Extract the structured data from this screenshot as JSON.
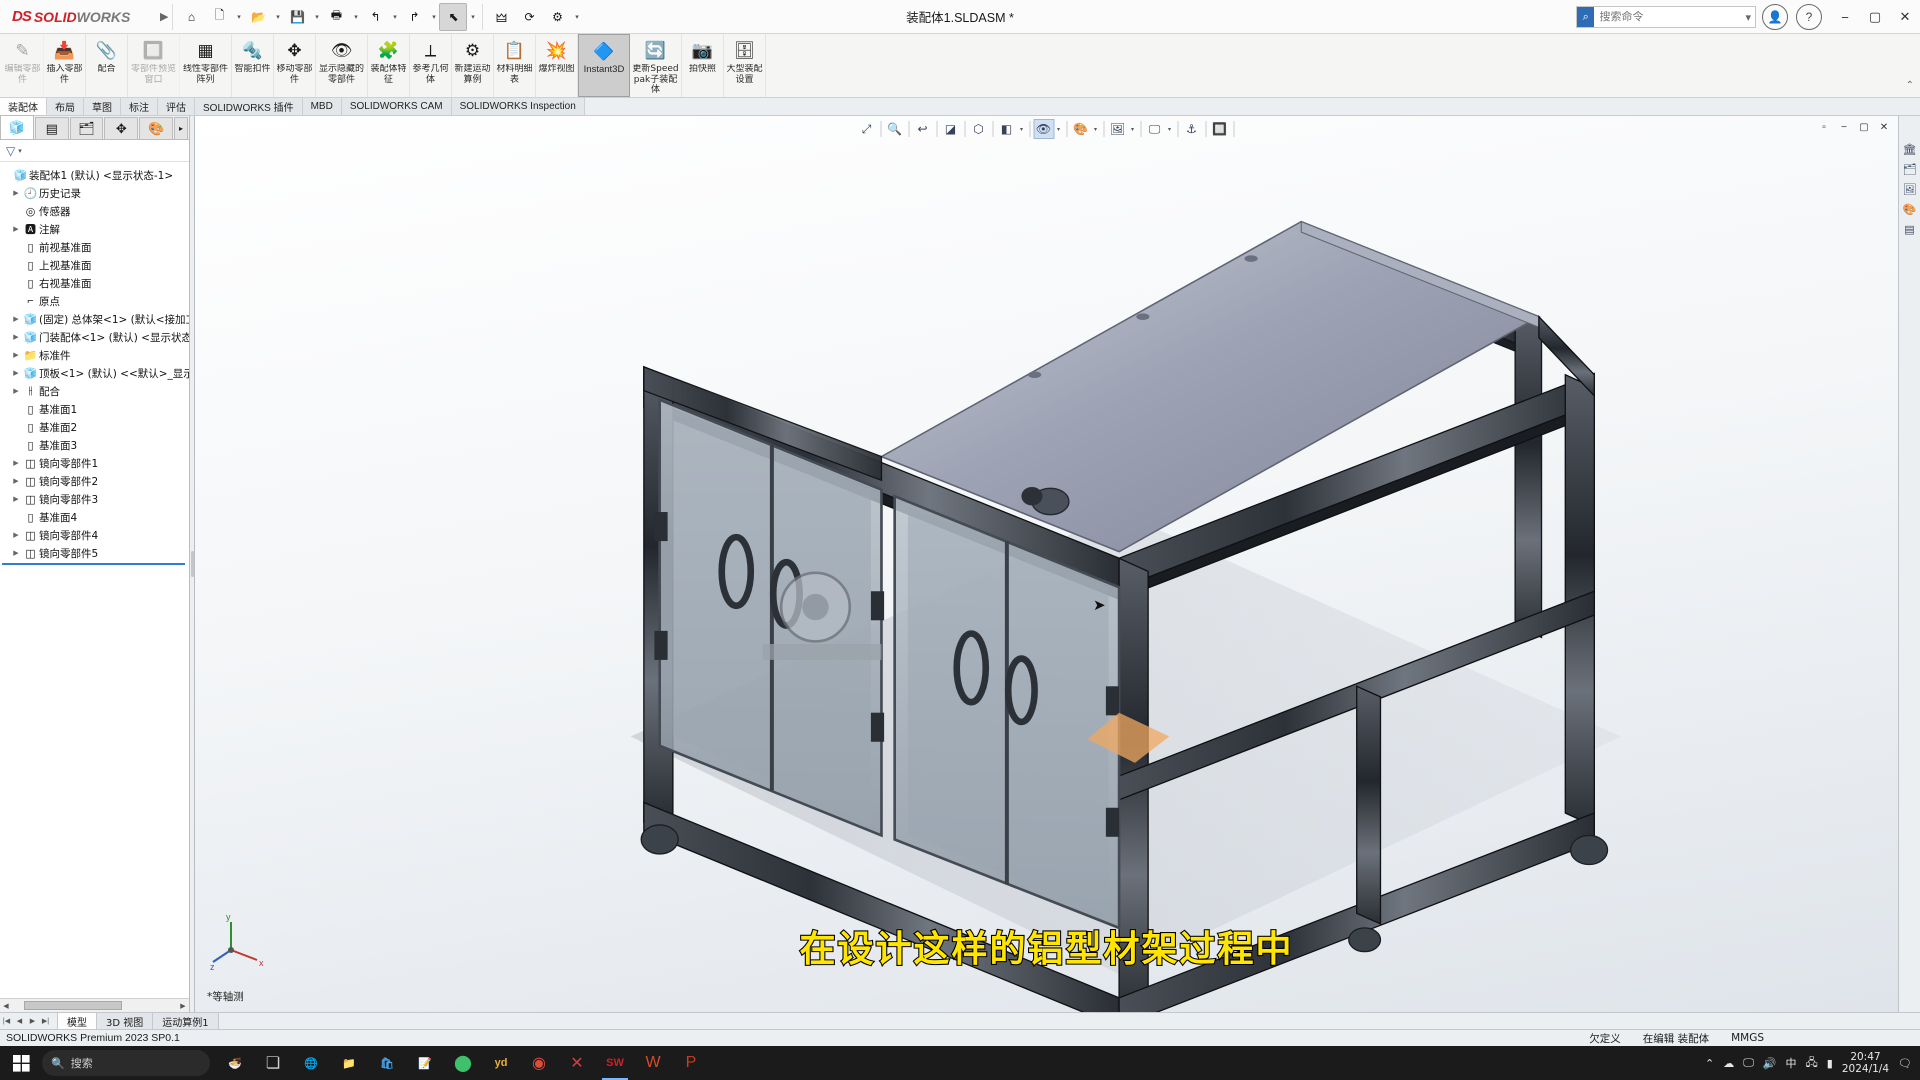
{
  "titlebar": {
    "brand_ds": "DS",
    "brand_sol": "SOLID",
    "brand_works": "WORKS",
    "menu_arrow": "▶",
    "document_title": "装配体1.SLDASM *",
    "search_placeholder": "搜索命令",
    "quick_access": [
      {
        "name": "home-icon",
        "glyph": "⌂",
        "caret": false
      },
      {
        "name": "new-document-icon",
        "glyph": "🗋",
        "caret": true
      },
      {
        "name": "open-folder-icon",
        "glyph": "📂",
        "caret": true
      },
      {
        "name": "save-icon",
        "glyph": "💾",
        "caret": true
      },
      {
        "name": "print-icon",
        "glyph": "🖶",
        "caret": true
      },
      {
        "name": "undo-icon",
        "glyph": "↰",
        "caret": true
      },
      {
        "name": "redo-icon",
        "glyph": "↱",
        "caret": true
      },
      {
        "name": "select-arrow-icon",
        "glyph": "⬉",
        "caret": true
      },
      {
        "name": "measure-icon",
        "glyph": "🜲",
        "caret": false
      },
      {
        "name": "rebuild-icon",
        "glyph": "⟳",
        "caret": false
      },
      {
        "name": "options-gear-icon",
        "glyph": "⚙",
        "caret": true
      }
    ],
    "window_controls": [
      "−",
      "▢",
      "✕"
    ],
    "account_icon": "👤",
    "help_icon": "?"
  },
  "ribbon": {
    "items": [
      {
        "label": "编辑零部件",
        "icon": "✎",
        "disabled": true
      },
      {
        "label": "插入零部件",
        "icon": "📥",
        "disabled": false
      },
      {
        "label": "配合",
        "icon": "📎",
        "disabled": false
      },
      {
        "label": "零部件预览窗口",
        "icon": "🔲",
        "disabled": true
      },
      {
        "label": "线性零部件阵列",
        "icon": "▦",
        "disabled": false
      },
      {
        "label": "智能扣件",
        "icon": "🔩",
        "disabled": false
      },
      {
        "label": "移动零部件",
        "icon": "✥",
        "disabled": false
      },
      {
        "label": "显示隐藏的零部件",
        "icon": "👁",
        "disabled": false
      },
      {
        "label": "装配体特征",
        "icon": "🧩",
        "disabled": false
      },
      {
        "label": "参考几何体",
        "icon": "⟂",
        "disabled": false
      },
      {
        "label": "新建运动算例",
        "icon": "⚙",
        "disabled": false
      },
      {
        "label": "材料明细表",
        "icon": "📋",
        "disabled": false
      },
      {
        "label": "爆炸视图",
        "icon": "💥",
        "disabled": false
      },
      {
        "label": "Instant3D",
        "icon": "🔷",
        "disabled": false,
        "active": true,
        "latin": true
      },
      {
        "label": "更新Speedpak子装配体",
        "icon": "🔄",
        "disabled": false
      },
      {
        "label": "拍快照",
        "icon": "📷",
        "disabled": false
      },
      {
        "label": "大型装配设置",
        "icon": "🗄",
        "disabled": false
      }
    ],
    "collapse_caret": "⌃"
  },
  "command_tabs": [
    {
      "label": "装配体",
      "active": true,
      "latin": false
    },
    {
      "label": "布局",
      "active": false,
      "latin": false
    },
    {
      "label": "草图",
      "active": false,
      "latin": false
    },
    {
      "label": "标注",
      "active": false,
      "latin": false
    },
    {
      "label": "评估",
      "active": false,
      "latin": false
    },
    {
      "label": "SOLIDWORKS 插件",
      "active": false,
      "latin": true
    },
    {
      "label": "MBD",
      "active": false,
      "latin": true
    },
    {
      "label": "SOLIDWORKS CAM",
      "active": false,
      "latin": true
    },
    {
      "label": "SOLIDWORKS Inspection",
      "active": false,
      "latin": true
    }
  ],
  "left_panel": {
    "tabs": [
      {
        "name": "feature-manager-tab",
        "icon": "🧊",
        "active": true
      },
      {
        "name": "property-manager-tab",
        "icon": "▤",
        "active": false
      },
      {
        "name": "configuration-manager-tab",
        "icon": "🗂",
        "active": false
      },
      {
        "name": "dimxpert-manager-tab",
        "icon": "✥",
        "active": false
      },
      {
        "name": "appearances-tab",
        "icon": "🎨",
        "active": false
      },
      {
        "name": "more-tab",
        "icon": "▸",
        "active": false
      }
    ],
    "filter_icon": "▽",
    "filter_caret": "▾",
    "tree": [
      {
        "label": "装配体1 (默认) <显示状态-1>",
        "icon": "🧊",
        "indent": 0,
        "arrow": false,
        "color": "#d4a017"
      },
      {
        "label": "历史记录",
        "icon": "🕘",
        "indent": 1,
        "arrow": true
      },
      {
        "label": "传感器",
        "icon": "◎",
        "indent": 1,
        "arrow": false
      },
      {
        "label": "注解",
        "icon": "🅰",
        "indent": 1,
        "arrow": true
      },
      {
        "label": "前视基准面",
        "icon": "▯",
        "indent": 1,
        "arrow": false
      },
      {
        "label": "上视基准面",
        "icon": "▯",
        "indent": 1,
        "arrow": false
      },
      {
        "label": "右视基准面",
        "icon": "▯",
        "indent": 1,
        "arrow": false
      },
      {
        "label": "原点",
        "icon": "⌐",
        "indent": 1,
        "arrow": false
      },
      {
        "label": "(固定) 总体架<1> (默认<接加工...",
        "icon": "🧊",
        "indent": 1,
        "arrow": true,
        "color": "#d4a017"
      },
      {
        "label": "门装配体<1> (默认) <显示状态-",
        "icon": "🧊",
        "indent": 1,
        "arrow": true,
        "color": "#7fa6cc"
      },
      {
        "label": "标准件",
        "icon": "📁",
        "indent": 1,
        "arrow": true,
        "color": "#3b82c4"
      },
      {
        "label": "顶板<1> (默认) <<默认>_显示状",
        "icon": "🧊",
        "indent": 1,
        "arrow": true,
        "color": "#d4a017"
      },
      {
        "label": "配合",
        "icon": "⫲",
        "indent": 1,
        "arrow": true
      },
      {
        "label": "基准面1",
        "icon": "▯",
        "indent": 1,
        "arrow": false
      },
      {
        "label": "基准面2",
        "icon": "▯",
        "indent": 1,
        "arrow": false
      },
      {
        "label": "基准面3",
        "icon": "▯",
        "indent": 1,
        "arrow": false
      },
      {
        "label": "镜向零部件1",
        "icon": "◫",
        "indent": 1,
        "arrow": true
      },
      {
        "label": "镜向零部件2",
        "icon": "◫",
        "indent": 1,
        "arrow": true
      },
      {
        "label": "镜向零部件3",
        "icon": "◫",
        "indent": 1,
        "arrow": true
      },
      {
        "label": "基准面4",
        "icon": "▯",
        "indent": 1,
        "arrow": false
      },
      {
        "label": "镜向零部件4",
        "icon": "◫",
        "indent": 1,
        "arrow": true
      },
      {
        "label": "镜向零部件5",
        "icon": "◫",
        "indent": 1,
        "arrow": true
      }
    ]
  },
  "viewport": {
    "toolbar": [
      {
        "name": "zoom-to-fit-icon",
        "glyph": "⤢",
        "caret": false
      },
      {
        "name": "zoom-to-area-icon",
        "glyph": "🔍",
        "caret": false
      },
      {
        "name": "previous-view-icon",
        "glyph": "↩",
        "caret": false
      },
      {
        "name": "section-view-icon",
        "glyph": "◪",
        "caret": false
      },
      {
        "name": "view-orientation-icon",
        "glyph": "⬡",
        "caret": false
      },
      {
        "name": "display-style-icon",
        "glyph": "◧",
        "caret": true
      },
      {
        "name": "hide-show-items-icon",
        "glyph": "👁",
        "caret": true,
        "selected": true
      },
      {
        "name": "appearances-icon",
        "glyph": "🎨",
        "caret": true
      },
      {
        "name": "scene-icon",
        "glyph": "🖼",
        "caret": true
      },
      {
        "name": "view-settings-icon",
        "glyph": "🖵",
        "caret": true
      },
      {
        "name": "apply-scene-icon",
        "glyph": "⚓",
        "caret": false
      },
      {
        "name": "hide-all-types-icon",
        "glyph": "🔲",
        "caret": false
      }
    ],
    "window_buttons": [
      "▫",
      "−",
      "▢",
      "✕"
    ],
    "view_label": "*等轴测",
    "axis": {
      "x": "x",
      "y": "y",
      "z": "z"
    }
  },
  "right_toolbar": [
    {
      "name": "design-library-icon",
      "glyph": "🏛"
    },
    {
      "name": "file-explorer-icon",
      "glyph": "🗂"
    },
    {
      "name": "view-palette-icon",
      "glyph": "🖼"
    },
    {
      "name": "appearances-scenes-icon",
      "glyph": "🎨"
    },
    {
      "name": "custom-properties-icon",
      "glyph": "▤"
    }
  ],
  "subtitle": "在设计这样的铝型材架过程中",
  "bottom_tabs": {
    "scroll_arrows": [
      "|◀",
      "◀",
      "▶",
      "▶|"
    ],
    "tabs": [
      {
        "label": "模型",
        "active": true
      },
      {
        "label": "3D 视图",
        "active": false
      },
      {
        "label": "运动算例1",
        "active": false
      }
    ]
  },
  "statusbar": {
    "left": "SOLIDWORKS Premium 2023 SP0.1",
    "state": "欠定义",
    "editing": "在编辑 装配体",
    "units": "MMGS"
  },
  "taskbar": {
    "search_placeholder": "搜索",
    "search_icon": "🔍",
    "start_icon": "⊞",
    "task_view_icon": "❏",
    "apps": [
      {
        "name": "app-icon-food",
        "glyph": "🍜",
        "color": "#e8762c"
      },
      {
        "name": "task-view-icon",
        "glyph": "❏",
        "color": "#cfcfcf"
      },
      {
        "name": "app-icon-edge",
        "glyph": "🌐",
        "color": "#3aa0e0"
      },
      {
        "name": "app-icon-explorer",
        "glyph": "📁",
        "color": "#e8b13a"
      },
      {
        "name": "app-icon-store",
        "glyph": "🛍",
        "color": "#4aa3e8"
      },
      {
        "name": "app-icon-note",
        "glyph": "📝",
        "color": "#4caf50"
      },
      {
        "name": "app-icon-green",
        "glyph": "⬤",
        "color": "#3ec16a"
      },
      {
        "name": "app-icon-yd",
        "glyph": "yd",
        "color": "#e8b13a"
      },
      {
        "name": "app-icon-chrome",
        "glyph": "◉",
        "color": "#dd4b39"
      },
      {
        "name": "app-icon-x",
        "glyph": "✕",
        "color": "#d04040"
      },
      {
        "name": "app-icon-solidworks",
        "glyph": "SW",
        "color": "#cf2127",
        "active": true
      },
      {
        "name": "app-icon-wps",
        "glyph": "W",
        "color": "#d74b2a"
      },
      {
        "name": "app-icon-powerpoint",
        "glyph": "P",
        "color": "#c43e1c"
      }
    ],
    "tray": [
      {
        "name": "show-hidden-icons",
        "glyph": "⌃"
      },
      {
        "name": "onedrive-icon",
        "glyph": "☁"
      },
      {
        "name": "monitor-icon",
        "glyph": "🖵"
      },
      {
        "name": "speaker-icon",
        "glyph": "🔊"
      },
      {
        "name": "ime-icon",
        "glyph": "中"
      },
      {
        "name": "network-icon",
        "glyph": "🖧"
      },
      {
        "name": "battery-icon",
        "glyph": "▮"
      }
    ],
    "clock_time": "20:47",
    "clock_date": "2024/1/4",
    "notification_icon": "🗨"
  }
}
